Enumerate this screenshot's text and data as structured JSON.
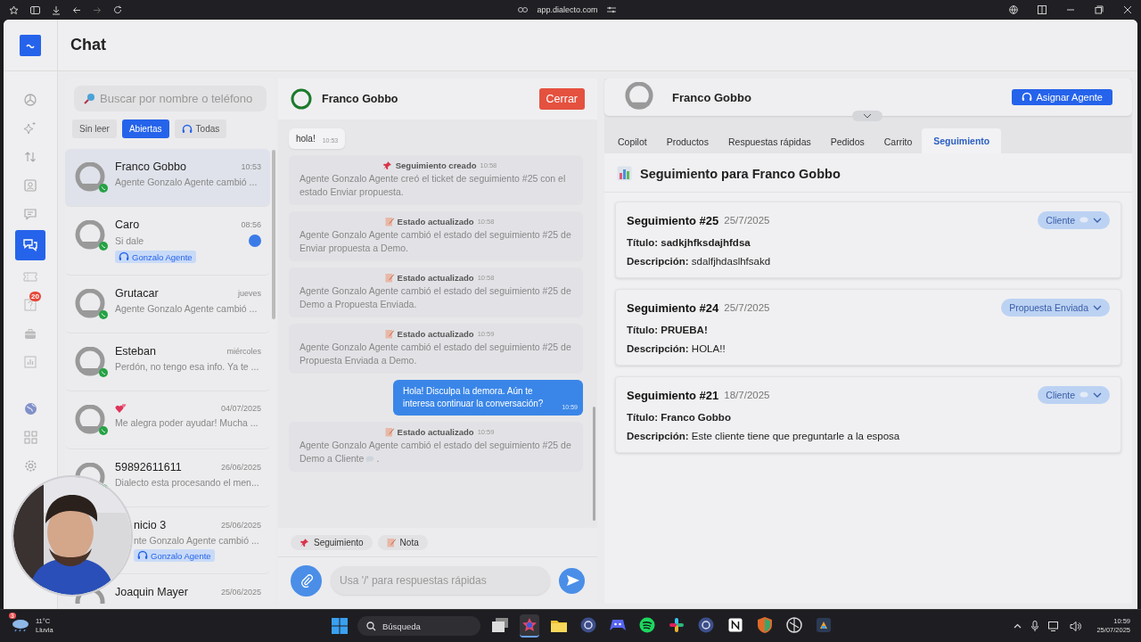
{
  "browser": {
    "url": "app.dialecto.com"
  },
  "nav": [
    {
      "kind": "dashboard",
      "selected": false
    },
    {
      "kind": "sparkle",
      "selected": false
    },
    {
      "kind": "arrows",
      "selected": false
    },
    {
      "kind": "contact",
      "selected": false
    },
    {
      "kind": "message",
      "selected": false
    },
    {
      "kind": "chat",
      "selected": true
    },
    {
      "kind": "ticket",
      "selected": false
    },
    {
      "kind": "help",
      "selected": false,
      "badge": "20"
    },
    {
      "kind": "bot",
      "selected": false
    },
    {
      "kind": "chart",
      "selected": false
    },
    {
      "kind": "gap"
    },
    {
      "kind": "globe",
      "selected": false
    },
    {
      "kind": "grid",
      "selected": false
    },
    {
      "kind": "gear",
      "selected": false
    }
  ],
  "header": {
    "title": "Chat"
  },
  "search": {
    "placeholder": "Buscar por nombre o teléfono"
  },
  "filters": [
    {
      "label": "Sin leer",
      "selected": false,
      "icon": false
    },
    {
      "label": "Abiertas",
      "selected": true,
      "icon": false
    },
    {
      "label": "Todas",
      "selected": false,
      "icon": true
    }
  ],
  "conversations": [
    {
      "kind": "text",
      "name": "Franco Gobbo",
      "time": "10:53",
      "preview": "Agente Gonzalo Agente cambió ...",
      "selected": true,
      "unread": false
    },
    {
      "kind": "text",
      "name": "Caro",
      "time": "08:56",
      "preview": "Si dale",
      "selected": false,
      "unread": true,
      "tag": "Gonzalo Agente"
    },
    {
      "kind": "text",
      "name": "Grutacar",
      "time": "jueves",
      "preview": "Agente Gonzalo Agente cambió ...",
      "selected": false,
      "unread": false
    },
    {
      "kind": "text",
      "name": "Esteban",
      "time": "miércoles",
      "preview": "Perdón, no tengo esa info. Ya te ...",
      "selected": false,
      "unread": false
    },
    {
      "kind": "hearts",
      "time": "04/07/2025",
      "preview": "Me alegra poder ayudar! Mucha ...",
      "selected": false,
      "unread": false
    },
    {
      "kind": "text",
      "name": "59892611611",
      "time": "26/06/2025",
      "preview": "Dialecto esta procesando el men...",
      "selected": false,
      "unread": false
    },
    {
      "kind": "covered",
      "name": "nicio 3",
      "time": "25/06/2025",
      "preview": "nte Gonzalo Agente cambió ...",
      "selected": false,
      "unread": false,
      "tag": "Gonzalo Agente"
    },
    {
      "kind": "text",
      "name": "Joaquin Mayer",
      "time": "25/06/2025",
      "selected": false
    }
  ],
  "chat": {
    "name": "Franco Gobbo",
    "close": "Cerrar",
    "messages": [
      {
        "kind": "incoming",
        "text": "hola!",
        "time": "10:53"
      },
      {
        "kind": "event_created",
        "title": "Seguimiento creado",
        "time": "10:58",
        "body": "Agente Gonzalo Agente creó el ticket de seguimiento #25 con el estado Enviar propuesta."
      },
      {
        "kind": "event_updated",
        "title": "Estado actualizado",
        "time": "10:58",
        "body": "Agente Gonzalo Agente cambió el estado del seguimiento #25 de Enviar propuesta a Demo."
      },
      {
        "kind": "event_updated",
        "title": "Estado actualizado",
        "time": "10:58",
        "body": "Agente Gonzalo Agente cambió el estado del seguimiento #25 de Demo a Propuesta Enviada."
      },
      {
        "kind": "event_updated",
        "title": "Estado actualizado",
        "time": "10:59",
        "body": "Agente Gonzalo Agente cambió el estado del seguimiento #25 de Propuesta Enviada a Demo."
      },
      {
        "kind": "outgoing",
        "text": "Hola! Disculpa la demora. Aún te interesa continuar la conversación?",
        "time": "10:59"
      },
      {
        "kind": "event_updated",
        "title": "Estado actualizado",
        "time": "10:59",
        "body": "Agente Gonzalo Agente cambió el estado del seguimiento #25 de",
        "continuation": "Demo a Cliente",
        "bubble": true,
        "body_end": "."
      }
    ],
    "actions": [
      {
        "kind": "follow_up",
        "label": "Seguimiento"
      },
      {
        "kind": "note",
        "label": "Nota"
      }
    ],
    "input": {
      "placeholder": "Usa '/' para respuestas rápidas"
    }
  },
  "contact": {
    "name": "Franco Gobbo",
    "assign": "Asignar Agente"
  },
  "tabs": [
    {
      "label": "Copilot",
      "selected": false
    },
    {
      "label": "Productos",
      "selected": false
    },
    {
      "label": "Respuestas rápidas",
      "selected": false
    },
    {
      "label": "Pedidos",
      "selected": false
    },
    {
      "label": "Carrito",
      "selected": false
    },
    {
      "label": "Seguimiento",
      "selected": true
    }
  ],
  "followups": {
    "title": "Seguimiento para Franco Gobbo",
    "items": [
      {
        "title": "Seguimiento #25",
        "date": "25/7/2025",
        "status": "Cliente",
        "bubble": true,
        "title_label": "Título:",
        "title_value": "sadkjhfksdajhfdsa",
        "desc_label": "Descripción:",
        "desc_value": "sdalfjhdaslhfsakd"
      },
      {
        "title": "Seguimiento #24",
        "date": "25/7/2025",
        "status": "Propuesta Enviada",
        "bubble": false,
        "title_label": "Título:",
        "title_value": "PRUEBA!",
        "desc_label": "Descripción:",
        "desc_value": "HOLA!!"
      },
      {
        "title": "Seguimiento #21",
        "date": "18/7/2025",
        "status": "Cliente",
        "bubble": true,
        "title_label": "Título:",
        "title_value": "Franco Gobbo",
        "desc_label": "Descripción:",
        "desc_value": "Este cliente tiene que preguntarle a la esposa"
      }
    ]
  },
  "taskbar": {
    "weather_badge": "3",
    "temperature": "11°C",
    "weather": "Lluvia",
    "search": "Búsqueda",
    "apps": [
      {
        "kind": "stack",
        "selected": false
      },
      {
        "kind": "star",
        "selected": true
      },
      {
        "kind": "folder",
        "selected": false
      },
      {
        "kind": "round",
        "selected": false
      },
      {
        "kind": "pad",
        "selected": false
      },
      {
        "kind": "green",
        "selected": false
      },
      {
        "kind": "flower",
        "selected": false
      },
      {
        "kind": "round",
        "selected": false
      },
      {
        "kind": "note",
        "selected": false
      },
      {
        "kind": "shield",
        "selected": false
      },
      {
        "kind": "ring",
        "selected": false
      },
      {
        "kind": "square",
        "selected": false
      }
    ],
    "time": "10:59",
    "date": "25/07/2025"
  }
}
